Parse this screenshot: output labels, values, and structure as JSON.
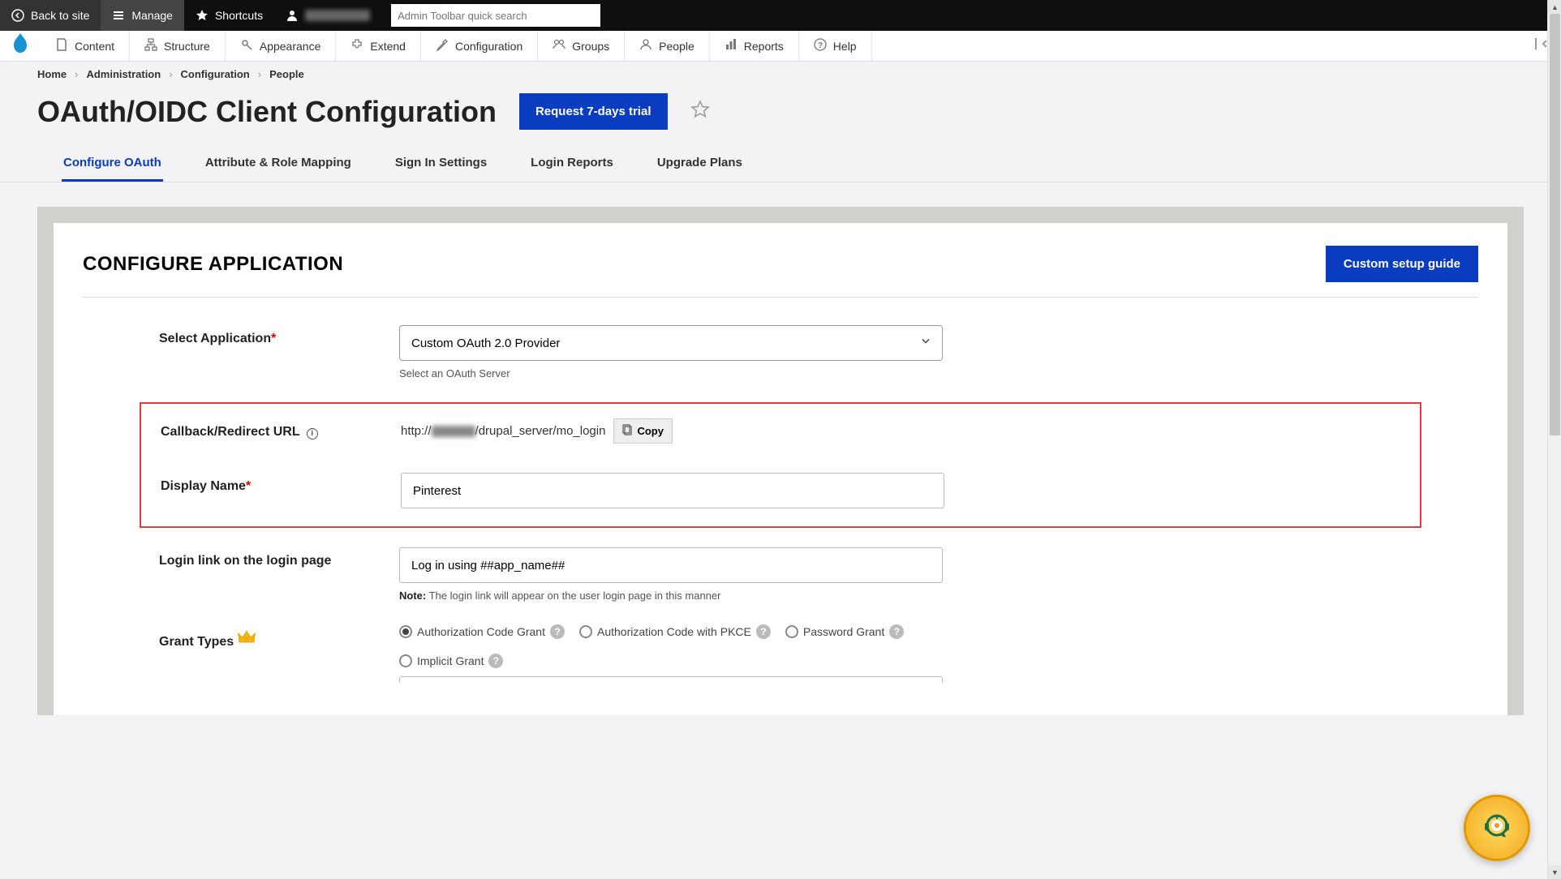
{
  "top_toolbar": {
    "back": "Back to site",
    "manage": "Manage",
    "shortcuts": "Shortcuts",
    "search_placeholder": "Admin Toolbar quick search"
  },
  "admin_menu": {
    "content": "Content",
    "structure": "Structure",
    "appearance": "Appearance",
    "extend": "Extend",
    "configuration": "Configuration",
    "groups": "Groups",
    "people": "People",
    "reports": "Reports",
    "help": "Help"
  },
  "breadcrumb": [
    "Home",
    "Administration",
    "Configuration",
    "People"
  ],
  "page": {
    "title": "OAuth/OIDC Client Configuration",
    "trial_btn": "Request 7-days trial"
  },
  "tabs": {
    "configure": "Configure OAuth",
    "attribute": "Attribute & Role Mapping",
    "signin": "Sign In Settings",
    "reports": "Login Reports",
    "upgrade": "Upgrade Plans"
  },
  "panel": {
    "heading": "CONFIGURE APPLICATION",
    "guide_btn": "Custom setup guide"
  },
  "form": {
    "select_app_label": "Select Application",
    "select_app_value": "Custom OAuth 2.0 Provider",
    "select_app_help": "Select an OAuth Server",
    "callback_label": "Callback/Redirect URL",
    "callback_prefix": "http://",
    "callback_suffix": "/drupal_server/mo_login",
    "copy_btn": "Copy",
    "display_name_label": "Display Name",
    "display_name_value": "Pinterest",
    "login_link_label": "Login link on the login page",
    "login_link_value": "Log in using ##app_name##",
    "login_link_note_label": "Note:",
    "login_link_note": " The login link will appear on the user login page in this manner",
    "grant_types_label": "Grant Types",
    "grants": {
      "auth_code": "Authorization Code Grant",
      "pkce": "Authorization Code with PKCE",
      "password": "Password Grant",
      "implicit": "Implicit Grant"
    }
  }
}
